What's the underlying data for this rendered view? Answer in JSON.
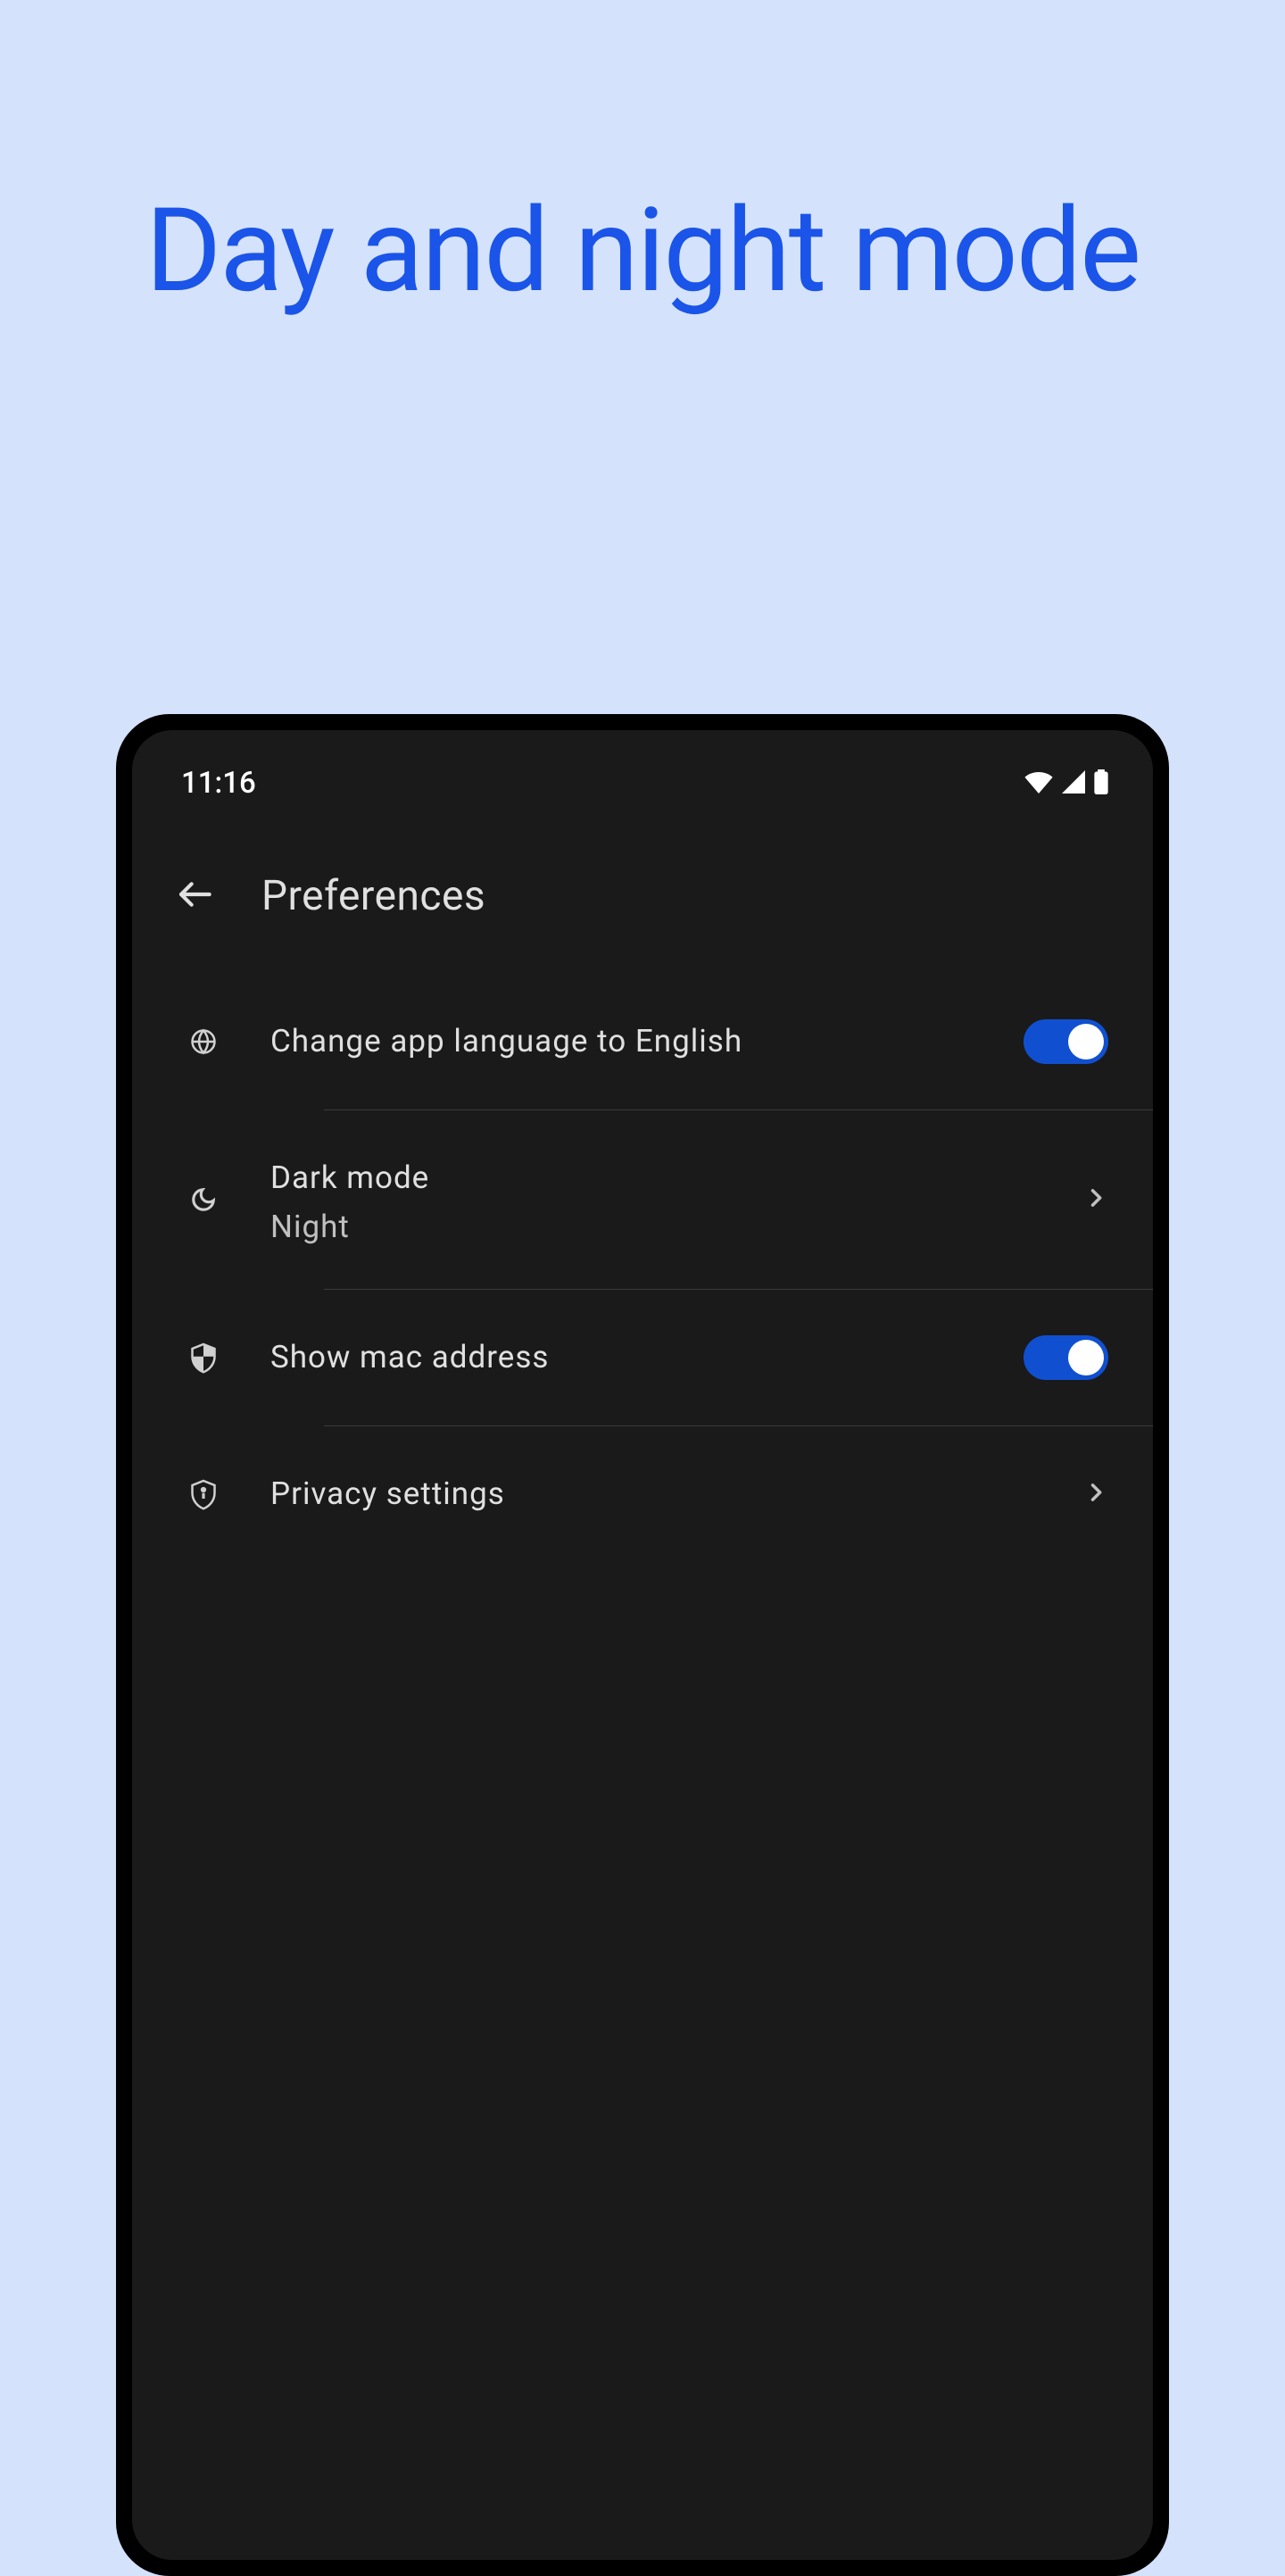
{
  "hero": {
    "title": "Day and night mode"
  },
  "statusBar": {
    "time": "11:16"
  },
  "header": {
    "title": "Preferences"
  },
  "settings": {
    "language": {
      "label": "Change app language to English",
      "toggled": true
    },
    "darkMode": {
      "label": "Dark mode",
      "value": "Night"
    },
    "macAddress": {
      "label": "Show mac address",
      "toggled": true
    },
    "privacy": {
      "label": "Privacy settings"
    }
  }
}
